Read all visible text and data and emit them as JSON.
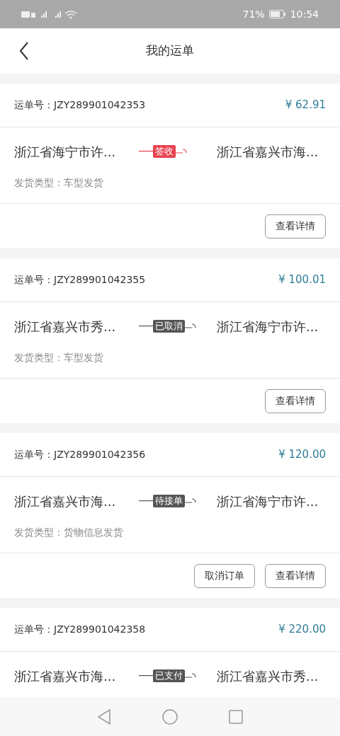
{
  "status_bar": {
    "battery": "71%",
    "time": "10:54"
  },
  "header": {
    "title": "我的运单"
  },
  "orders": [
    {
      "order_no": "运单号：JZY289901042353",
      "price": "¥ 62.91",
      "from": "浙江省海宁市许...",
      "status": {
        "text": "签收",
        "color": "#e8414f"
      },
      "to": "浙江省嘉兴市海...",
      "type": "发货类型：车型发货",
      "buttons": [
        "查看详情"
      ]
    },
    {
      "order_no": "运单号：JZY289901042355",
      "price": "¥ 100.01",
      "from": "浙江省嘉兴市秀...",
      "status": {
        "text": "已取消",
        "color": "#555555"
      },
      "to": "浙江省海宁市许...",
      "type": "发货类型：车型发货",
      "buttons": [
        "查看详情"
      ]
    },
    {
      "order_no": "运单号：JZY289901042356",
      "price": "¥ 120.00",
      "from": "浙江省嘉兴市海...",
      "status": {
        "text": "待接单",
        "color": "#555555"
      },
      "to": "浙江省海宁市许...",
      "type": "发货类型：货物信息发货",
      "buttons": [
        "取消订单",
        "查看详情"
      ]
    },
    {
      "order_no": "运单号：JZY289901042358",
      "price": "¥ 220.00",
      "from": "浙江省嘉兴市海...",
      "status": {
        "text": "已支付",
        "color": "#555555"
      },
      "to": "浙江省嘉兴市秀..."
    }
  ]
}
